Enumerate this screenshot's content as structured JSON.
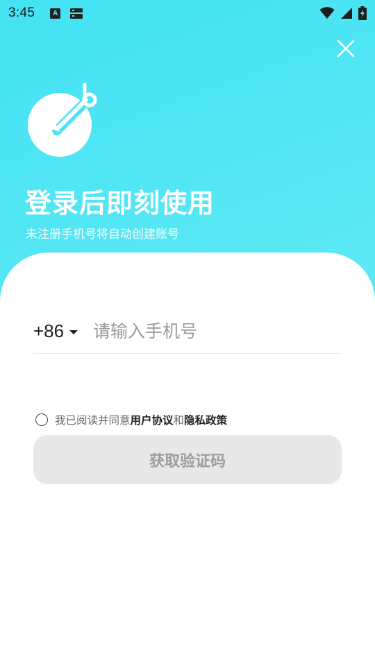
{
  "status_bar": {
    "time": "3:45",
    "notification_icon_letter": "A"
  },
  "header": {
    "title": "登录后即刻使用",
    "subtitle": "未注册手机号将自动创建账号"
  },
  "form": {
    "country_code": "+86",
    "phone_placeholder": "请输入手机号",
    "phone_value": ""
  },
  "agreement": {
    "prefix": "我已阅读并同意",
    "user_agreement": "用户协议",
    "and": "和",
    "privacy_policy": "隐私政策",
    "checked": false
  },
  "actions": {
    "get_code_label": "获取验证码"
  },
  "colors": {
    "header_gradient_start": "#43e2f3",
    "header_gradient_end": "#5ee9f5",
    "button_bg_disabled": "#e8e8e8",
    "button_text_disabled": "#9d9d9d"
  },
  "icons": {
    "close": "close-icon",
    "logo": "app-logo-icon",
    "wifi": "wifi-icon",
    "signal": "cellular-signal-icon",
    "battery": "battery-charging-icon"
  }
}
